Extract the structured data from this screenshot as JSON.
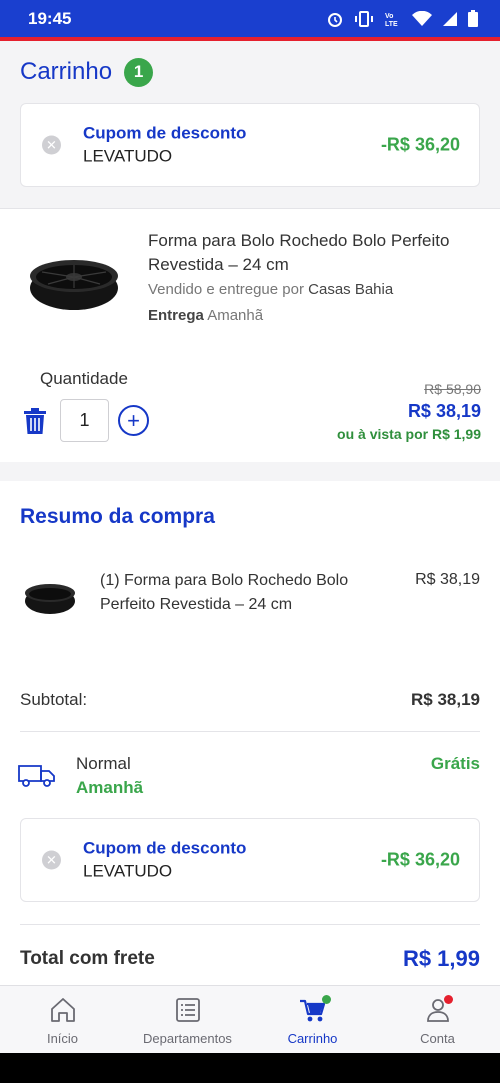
{
  "status": {
    "time": "19:45"
  },
  "header": {
    "title": "Carrinho",
    "badge": "1"
  },
  "coupon": {
    "label": "Cupom de desconto",
    "code": "LEVATUDO",
    "value": "-R$ 36,20"
  },
  "product": {
    "name": "Forma para Bolo Rochedo Bolo Perfeito Revestida – 24 cm",
    "seller_prefix": "Vendido e entregue por",
    "seller": "Casas Bahia",
    "delivery_label": "Entrega",
    "delivery_value": "Amanhã",
    "quantity_label": "Quantidade",
    "quantity": "1",
    "old_price": "R$ 58,90",
    "price": "R$ 38,19",
    "cash_price": "ou à vista por R$ 1,99"
  },
  "summary": {
    "title": "Resumo da compra",
    "item_name": "(1) Forma para Bolo Rochedo Bolo Perfeito Revestida – 24 cm",
    "item_price": "R$ 38,19",
    "subtotal_label": "Subtotal:",
    "subtotal_value": "R$ 38,19",
    "shipping_name": "Normal",
    "shipping_when": "Amanhã",
    "shipping_price": "Grátis",
    "total_label": "Total com frete",
    "total_value": "R$ 1,99"
  },
  "nav": [
    {
      "label": "Início",
      "icon": "home-icon"
    },
    {
      "label": "Departamentos",
      "icon": "list-icon"
    },
    {
      "label": "Carrinho",
      "icon": "cart-icon"
    },
    {
      "label": "Conta",
      "icon": "user-icon"
    }
  ],
  "colors": {
    "brand_blue": "#1638c7",
    "status_blue": "#1a3fcf",
    "accent_red": "#e5202e",
    "green": "#3aa64b"
  }
}
